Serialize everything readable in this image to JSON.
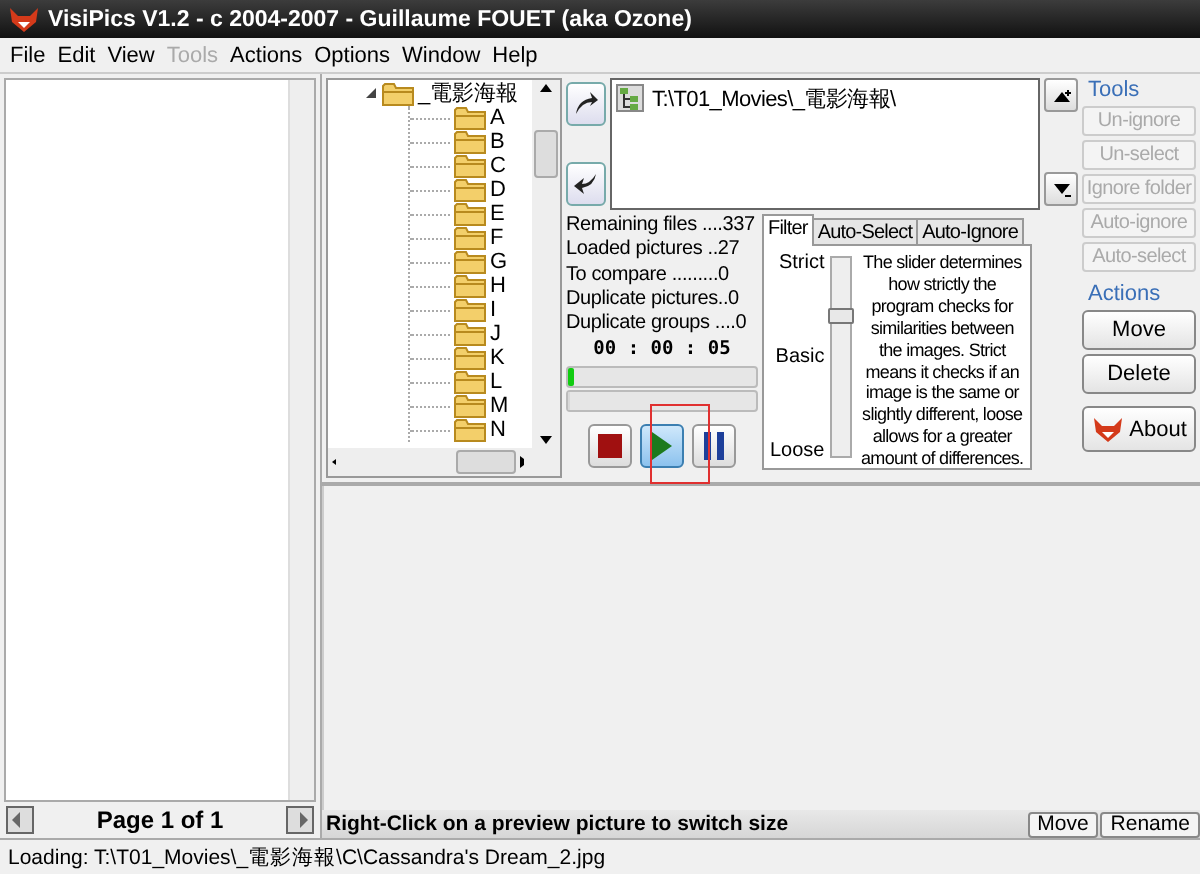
{
  "window": {
    "title": "VisiPics V1.2 - c 2004-2007 - Guillaume FOUET (aka Ozone)"
  },
  "menu": [
    {
      "label": "File",
      "disabled": false
    },
    {
      "label": "Edit",
      "disabled": false
    },
    {
      "label": "View",
      "disabled": false
    },
    {
      "label": "Tools",
      "disabled": true
    },
    {
      "label": "Actions",
      "disabled": false
    },
    {
      "label": "Options",
      "disabled": false
    },
    {
      "label": "Window",
      "disabled": false
    },
    {
      "label": "Help",
      "disabled": false
    }
  ],
  "folder_tree": {
    "label": "_電影海報",
    "expanded": true,
    "children": [
      {
        "label": "A"
      },
      {
        "label": "B"
      },
      {
        "label": "C"
      },
      {
        "label": "D"
      },
      {
        "label": "E"
      },
      {
        "label": "F"
      },
      {
        "label": "G"
      },
      {
        "label": "H"
      },
      {
        "label": "I"
      },
      {
        "label": "J"
      },
      {
        "label": "K"
      },
      {
        "label": "L"
      },
      {
        "label": "M"
      },
      {
        "label": "N"
      }
    ]
  },
  "folder_path": "T:\\T01_Movies\\_電影海報\\",
  "stats": [
    "Remaining files ....337",
    "Loaded pictures ..27",
    "To compare .........0",
    "Duplicate pictures..0",
    "Duplicate groups ....0"
  ],
  "timer": "00 : 00 : 05",
  "progress": [
    {
      "level": 0.03
    },
    {
      "level": 0
    }
  ],
  "controls": [
    {
      "kind": "stop",
      "selected": false
    },
    {
      "kind": "play",
      "selected": true
    },
    {
      "kind": "pause",
      "selected": false
    }
  ],
  "tabs": [
    {
      "label": "Filter",
      "selected": true
    },
    {
      "label": "Auto-Select",
      "selected": false
    },
    {
      "label": "Auto-Ignore",
      "selected": false
    }
  ],
  "filter": {
    "labels": [
      "Strict",
      "Basic",
      "Loose"
    ],
    "level": 0.72,
    "description": "The slider determines how strictly the program checks for similarities between the images. Strict means it checks if an image is the same or slightly different, loose allows for a greater amount of differences."
  },
  "tools": {
    "title": "Tools",
    "buttons": [
      {
        "label": "Un-ignore",
        "disabled": true
      },
      {
        "label": "Un-select",
        "disabled": true
      },
      {
        "label": "Ignore folder",
        "disabled": true
      },
      {
        "label": "Auto-ignore",
        "disabled": true
      },
      {
        "label": "Auto-select",
        "disabled": true
      }
    ]
  },
  "actions": {
    "title": "Actions",
    "buttons": [
      {
        "label": "Move",
        "kind": "plain"
      },
      {
        "label": "Delete",
        "kind": "plain"
      },
      {
        "label": "About",
        "kind": "logo"
      }
    ]
  },
  "pager": "Page 1 of 1",
  "hint": "Right-Click on a preview picture to switch size",
  "preview_buttons": [
    "Move",
    "Rename"
  ],
  "status": "Loading: T:\\T01_Movies\\_電影海報\\C\\Cassandra's Dream_2.jpg"
}
